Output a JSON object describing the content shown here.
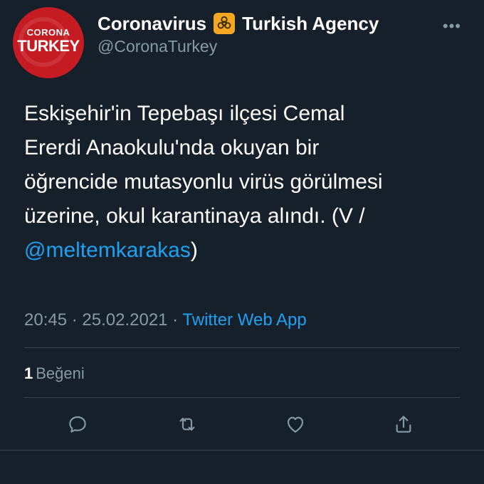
{
  "account": {
    "avatar_line1": "CORONA",
    "avatar_line2": "TURKEY",
    "name_part1": "Coronavirus",
    "name_icon": "biohazard-icon",
    "name_part2": "Turkish Agency",
    "handle": "@CoronaTurkey",
    "more": "•••"
  },
  "tweet": {
    "text": "Eskişehir'in Tepebaşı ilçesi Cemal\nErerdi Anaokulu'nda okuyan bir\nöğrencide mutasyonlu virüs görülmesi\nüzerine, okul karantinaya alındı. (V / ",
    "mention": "@meltemkarakas",
    "text_end": ")"
  },
  "meta": {
    "time": "20:45",
    "separator": " · ",
    "date": "25.02.2021",
    "source": "Twitter Web App"
  },
  "stats": {
    "likes_count": "1",
    "likes_label": "Beğeni"
  },
  "actions": [
    "reply-icon",
    "retweet-icon",
    "like-icon",
    "share-icon"
  ],
  "colors": {
    "background": "#15202b",
    "link": "#1da1f2",
    "secondary": "#8899a6",
    "divider": "#38444d",
    "brand_red": "#c51b22",
    "biohazard_bg": "#f5a623"
  }
}
